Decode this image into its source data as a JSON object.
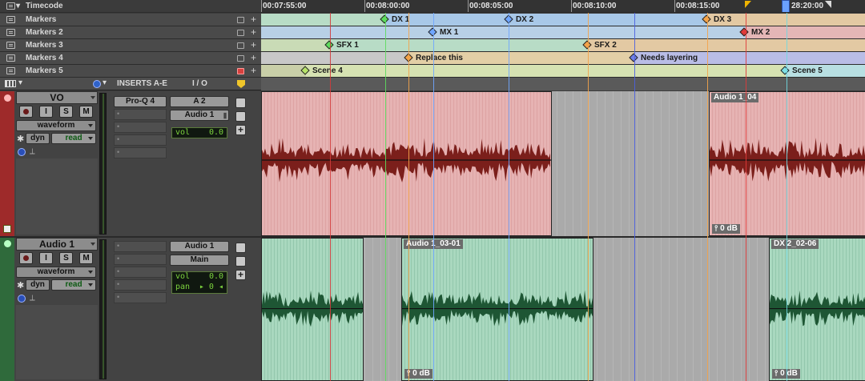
{
  "colors": {
    "vo_track": "#9e2a2a",
    "audio_track": "#2f6a3b",
    "vo_clip": "#e6b3b3",
    "audio_clip": "#a9d8bf",
    "vo_wave": "#7b1f1b",
    "audio_wave": "#1e5634",
    "marker_green": "#5ddc5d",
    "marker_blue": "#6fa6ff",
    "marker_orange": "#f3a34a",
    "marker_red": "#e03a3a"
  },
  "rulers": [
    {
      "name": "Timecode",
      "type": "timecode",
      "ticks": [
        {
          "label": "00:07:55:00"
        },
        {
          "label": "00:08:00:00"
        },
        {
          "label": "00:08:05:00"
        },
        {
          "label": "00:08:10:00"
        },
        {
          "label": "00:08:15:00"
        },
        {
          "label": "28:20:00"
        }
      ]
    },
    {
      "name": "Markers",
      "type": "markers",
      "markers": [
        {
          "label": "DX 1",
          "color": "#5ddc5d"
        },
        {
          "label": "DX 2",
          "color": "#6fa6ff"
        },
        {
          "label": "DX 3",
          "color": "#f3a34a"
        }
      ]
    },
    {
      "name": "Markers 2",
      "type": "markers",
      "markers": [
        {
          "label": "MX 1",
          "color": "#6fa6ff"
        },
        {
          "label": "MX 2",
          "color": "#e03a3a"
        }
      ]
    },
    {
      "name": "Markers 3",
      "type": "markers",
      "markers": [
        {
          "label": "SFX 1",
          "color": "#5ddc5d"
        },
        {
          "label": "SFX 2",
          "color": "#f3a34a"
        }
      ]
    },
    {
      "name": "Markers 4",
      "type": "markers",
      "markers": [
        {
          "label": "Replace this",
          "color": "#f3a34a"
        },
        {
          "label": "Needs layering",
          "color": "#6f7fe6"
        }
      ]
    },
    {
      "name": "Markers 5",
      "type": "markers",
      "markers": [
        {
          "label": "Scene 4",
          "color": "#b7e36a"
        },
        {
          "label": "Scene 5",
          "color": "#7fe0e6"
        }
      ]
    }
  ],
  "columns": {
    "inserts": "INSERTS A-E",
    "io": "I / O"
  },
  "tracks": [
    {
      "name": "VO",
      "buttons": [
        "",
        "I",
        "S",
        "M"
      ],
      "view": "waveform",
      "automation": {
        "dyn": "dyn",
        "mode": "read"
      },
      "inserts": [
        "Pro-Q 4",
        "•",
        "•",
        "•",
        "•"
      ],
      "io": {
        "input": "A 2",
        "output": "Audio 1",
        "vol_label": "vol",
        "vol_value": "0.0"
      },
      "clips": [
        {
          "name": "",
          "gain": ""
        },
        {
          "name": "Audio 1_04",
          "gain": "0 dB"
        }
      ]
    },
    {
      "name": "Audio 1",
      "buttons": [
        "",
        "I",
        "S",
        "M"
      ],
      "view": "waveform",
      "automation": {
        "dyn": "dyn",
        "mode": "read"
      },
      "inserts": [
        "•",
        "•",
        "•",
        "•",
        "•"
      ],
      "io": {
        "input": "Audio 1",
        "output": "Main",
        "vol_label": "vol",
        "vol_value": "0.0",
        "pan_label": "pan",
        "pan_value": "0"
      },
      "clips": [
        {
          "name": "",
          "gain": ""
        },
        {
          "name": "Audio 1_03-01",
          "gain": "0 dB"
        },
        {
          "name": "DX 2_02-06",
          "gain": "0 dB"
        }
      ]
    }
  ]
}
